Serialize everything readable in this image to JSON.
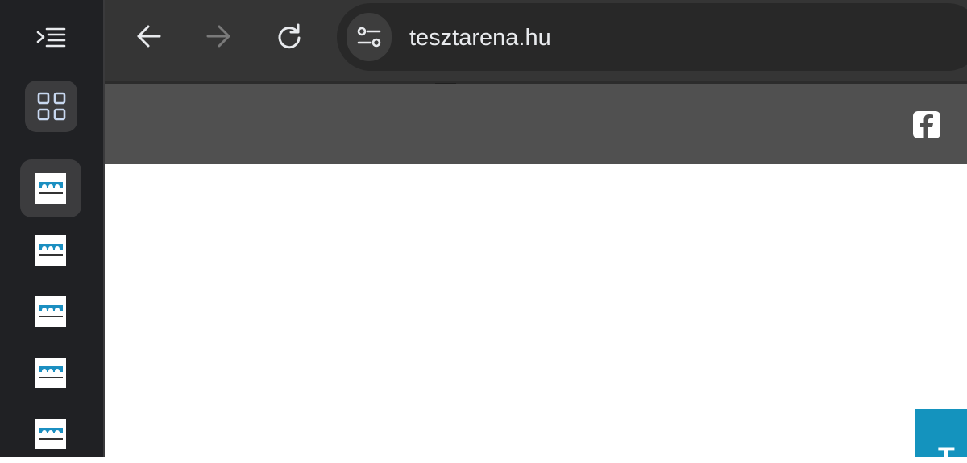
{
  "sidebar": {
    "collapse_icon": "collapse-tabs-icon",
    "tab_grid_icon": "tab-grid-icon",
    "tabs": [
      {
        "favicon": "tesztarena-logo",
        "active": true
      },
      {
        "favicon": "tesztarena-logo",
        "active": false
      },
      {
        "favicon": "tesztarena-logo",
        "active": false
      },
      {
        "favicon": "tesztarena-logo",
        "active": false
      },
      {
        "favicon": "tesztarena-logo",
        "active": false
      }
    ]
  },
  "toolbar": {
    "back_icon": "back-arrow-icon",
    "forward_icon": "forward-arrow-icon",
    "forward_enabled": false,
    "reload_icon": "reload-icon",
    "site_info_icon": "site-settings-icon",
    "url": "tesztarena.hu"
  },
  "page": {
    "header_icon": "facebook-icon",
    "corner_text": "T"
  },
  "colors": {
    "sidebar_bg": "#202124",
    "toolbar_bg": "#353535",
    "omnibox_bg": "#282828",
    "page_header_bg": "#505050",
    "accent_blue": "#1493be",
    "logo_blue": "#1b8fc1"
  }
}
